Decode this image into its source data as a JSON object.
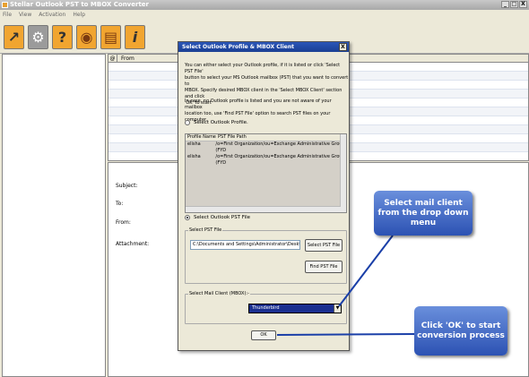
{
  "app": {
    "title": "Stellar Outlook PST to MBOX Converter",
    "window_buttons": [
      "_",
      "□",
      "X"
    ]
  },
  "menu": [
    "File",
    "View",
    "Activation",
    "Help"
  ],
  "toolbar_icons": [
    "open-icon",
    "tool-icon",
    "help-icon",
    "globe-icon",
    "cart-icon",
    "info-icon"
  ],
  "toolbar_glyphs": [
    "↗",
    "⚙",
    "?",
    "◉",
    "▤",
    "i"
  ],
  "list": {
    "attach_col": "@",
    "from_col": "From"
  },
  "preview": {
    "subject": "Subject:",
    "to": "To:",
    "from": "From:",
    "attachment": "Attachment:"
  },
  "dialog": {
    "title": "Select Outlook Profile & MBOX Client",
    "close": "X",
    "intro_1": "You can either select your Outlook profile, if it is listed or click 'Select PST File'",
    "intro_2": "button to select your MS Outlook mailbox (PST) that you want to convert to",
    "intro_3": "MBOX. Specify desired MBOX client in the 'Select MBOX Client' section and click",
    "intro_4": "'OK' to start",
    "note_1": "In case, no Outlook profile is listed and you are not aware of your mailbox",
    "note_2": "location too, use 'Find PST File' option to search PST files on your computer.",
    "radio_profile": "Select Outlook Profile.",
    "profile_headers": [
      "Profile Name",
      "PST File Path"
    ],
    "profiles": [
      {
        "name": "elisha",
        "path": "/o=First Organization/ou=Exchange Administrative Group (FYD"
      },
      {
        "name": "elisha",
        "path": "/o=First Organization/ou=Exchange Administrative Group (FYD"
      }
    ],
    "radio_pst": "Select Outlook PST File",
    "pst_group": "Select PST File",
    "pst_path": "C:\\Documents and Settings\\Administrator\\Desktop\\P",
    "select_pst_button": "Select PST File",
    "find_pst_button": "Find PST File",
    "mail_group": "Select Mail Client (MBOX):-",
    "mail_client": "Thunderbird",
    "ok_button": "OK"
  },
  "callouts": {
    "mail_client": "Select mail client from the drop down menu",
    "ok": "Click 'OK' to start conversion process"
  },
  "colors": {
    "callout": "#3a62c4",
    "dialog_title": "#1f48a6",
    "select": "#1a2f8f"
  }
}
